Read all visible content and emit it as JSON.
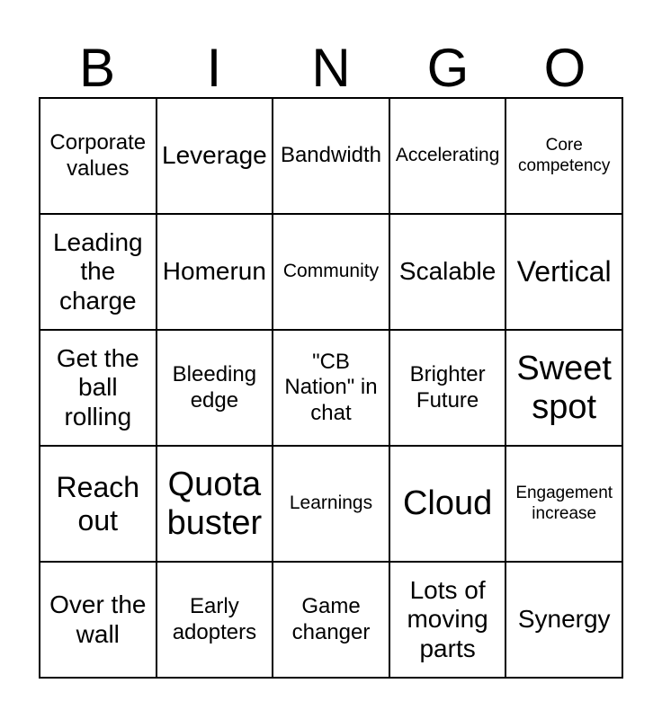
{
  "card": {
    "header_letters": [
      "B",
      "I",
      "N",
      "G",
      "O"
    ],
    "rows": 5,
    "columns": 5,
    "colors": {
      "background": "#ffffff",
      "text": "#000000",
      "grid_line": "#000000"
    },
    "cells": [
      [
        {
          "text": "Corporate values",
          "size": "md"
        },
        {
          "text": "Leverage",
          "size": "lg"
        },
        {
          "text": "Bandwidth",
          "size": "md"
        },
        {
          "text": "Accelerating",
          "size": "sm"
        },
        {
          "text": "Core competency",
          "size": "xs"
        }
      ],
      [
        {
          "text": "Leading the charge",
          "size": "lg"
        },
        {
          "text": "Homerun",
          "size": "lg"
        },
        {
          "text": "Community",
          "size": "sm"
        },
        {
          "text": "Scalable",
          "size": "lg"
        },
        {
          "text": "Vertical",
          "size": "xl"
        }
      ],
      [
        {
          "text": "Get the ball rolling",
          "size": "lg"
        },
        {
          "text": "Bleeding edge",
          "size": "md"
        },
        {
          "text": "\"CB Nation\" in chat",
          "size": "md"
        },
        {
          "text": "Brighter Future",
          "size": "md"
        },
        {
          "text": "Sweet spot",
          "size": "xxl"
        }
      ],
      [
        {
          "text": "Reach out",
          "size": "xl"
        },
        {
          "text": "Quota buster",
          "size": "xxl"
        },
        {
          "text": "Learnings",
          "size": "sm"
        },
        {
          "text": "Cloud",
          "size": "xxl"
        },
        {
          "text": "Engagement increase",
          "size": "xs"
        }
      ],
      [
        {
          "text": "Over the wall",
          "size": "lg"
        },
        {
          "text": "Early adopters",
          "size": "md"
        },
        {
          "text": "Game changer",
          "size": "md"
        },
        {
          "text": "Lots of moving parts",
          "size": "lg"
        },
        {
          "text": "Synergy",
          "size": "lg"
        }
      ]
    ]
  }
}
